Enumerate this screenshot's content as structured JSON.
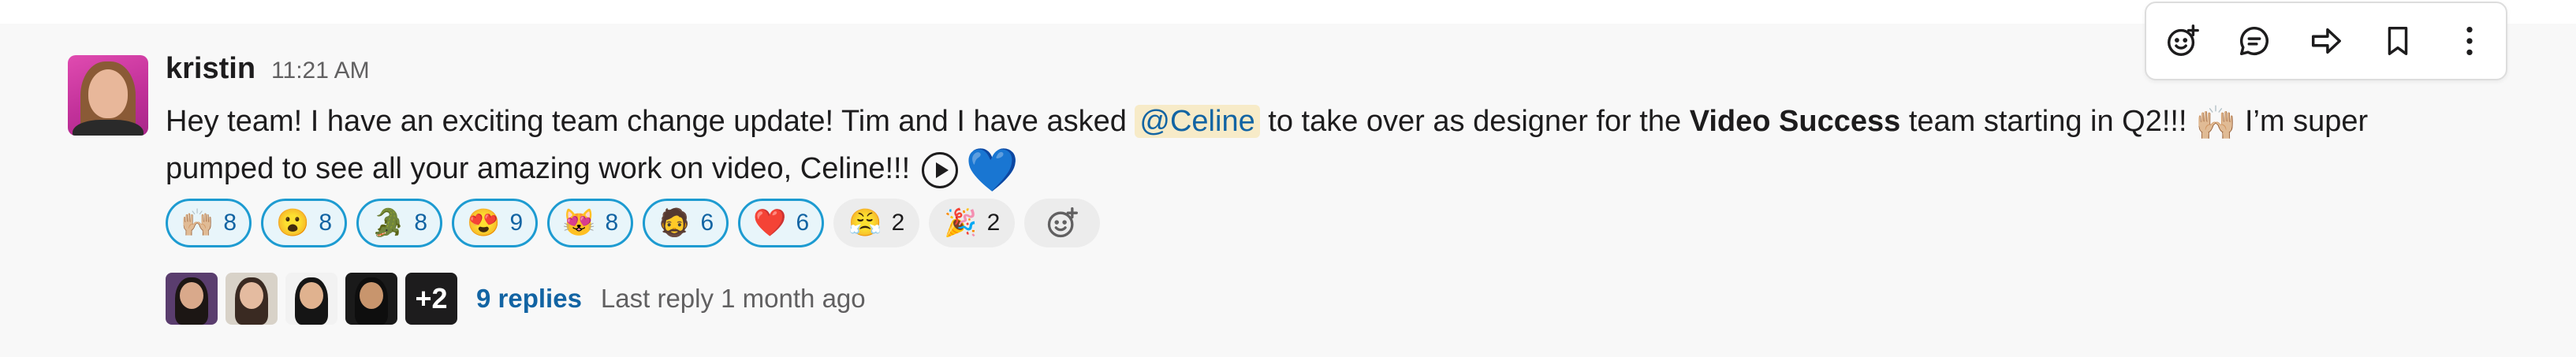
{
  "message": {
    "author": "kristin",
    "time": "11:21 AM",
    "text_part1": "Hey team! I have an exciting team change update! Tim and I have asked ",
    "mention": "@Celine",
    "text_part2": " to take over as designer for the ",
    "bold_text": "Video Success",
    "text_part3": " team starting in Q2!!! ",
    "emoji_raised_hands": "🙌🏼",
    "text_part4": " I’m super pumped to see all your amazing work on video, Celine!!! ",
    "emoji_blue_heart": "💙"
  },
  "reactions": [
    {
      "emoji": "🙌🏼",
      "count": "8",
      "active": true
    },
    {
      "emoji": "😮",
      "count": "8",
      "active": true
    },
    {
      "emoji": "🐊",
      "count": "8",
      "active": true
    },
    {
      "emoji": "😍",
      "count": "9",
      "active": true
    },
    {
      "emoji": "😻",
      "count": "8",
      "active": true
    },
    {
      "emoji": "🧔",
      "count": "6",
      "active": true
    },
    {
      "emoji": "❤️",
      "count": "6",
      "active": true
    },
    {
      "emoji": "😤",
      "count": "2",
      "active": false
    },
    {
      "emoji": "🎉",
      "count": "2",
      "active": false
    }
  ],
  "thread": {
    "more_count": "+2",
    "reply_count": "9 replies",
    "last_reply": "Last reply 1 month ago"
  },
  "toolbar": {
    "icons": [
      "add-reaction-icon",
      "reply-in-thread-icon",
      "forward-icon",
      "bookmark-icon",
      "more-actions-icon"
    ]
  },
  "colors": {
    "link": "#1264a3",
    "active_border": "#1d9bd1",
    "mention_bg": "#f7ebc8",
    "avatar_bg": "#c2319a"
  }
}
